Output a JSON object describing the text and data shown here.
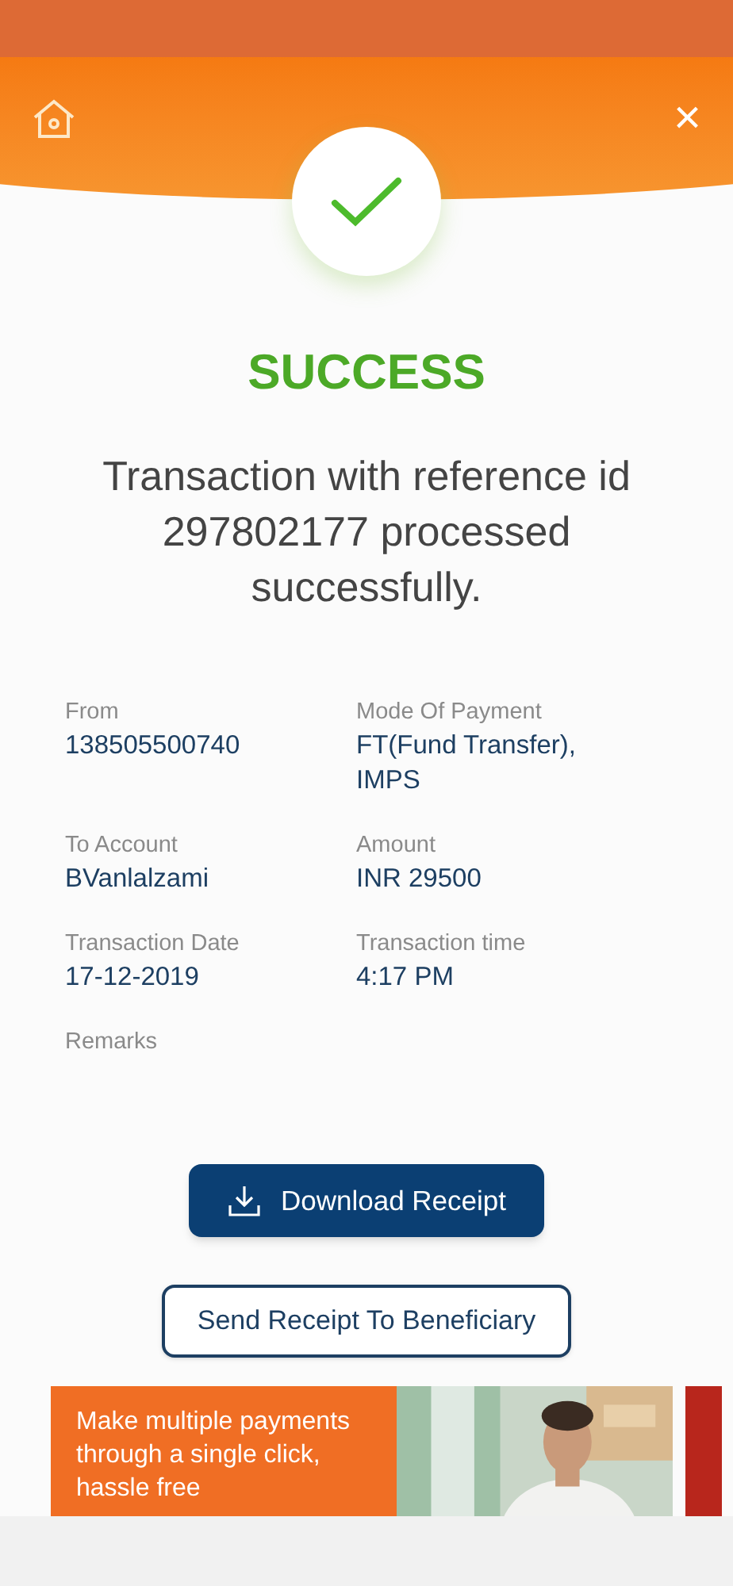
{
  "header": {
    "close": "×"
  },
  "status": {
    "title": "SUCCESS",
    "message": "Transaction with reference id 297802177 processed successfully."
  },
  "details": [
    {
      "label": "From",
      "value": "138505500740"
    },
    {
      "label": "Mode Of Payment",
      "value": "FT(Fund Transfer), IMPS"
    },
    {
      "label": "To Account",
      "value": "BVanlalzami"
    },
    {
      "label": "Amount",
      "value": "INR 29500"
    },
    {
      "label": "Transaction Date",
      "value": "17-12-2019"
    },
    {
      "label": "Transaction time",
      "value": "4:17 PM"
    },
    {
      "label": "Remarks"
    }
  ],
  "buttons": [
    {
      "label": "Download Receipt",
      "kind": "primary"
    },
    {
      "label": "Send Receipt To Beneficiary",
      "kind": "outline"
    }
  ],
  "banner": {
    "text": "Make multiple payments through a single click, hassle free",
    "kind": "picture"
  }
}
